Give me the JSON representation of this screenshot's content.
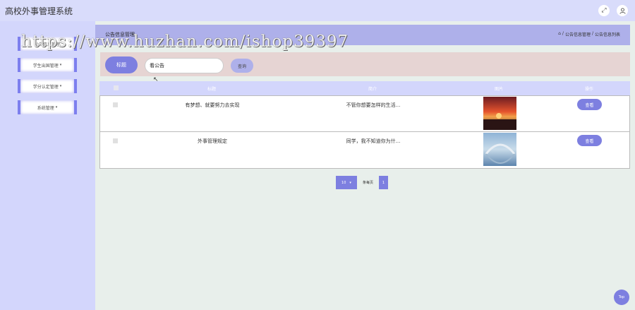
{
  "app": {
    "title": "高校外事管理系统"
  },
  "header_icons": [
    "fullscreen-icon",
    "user-icon"
  ],
  "sidebar": {
    "items": [
      {
        "label": "公告信息管理"
      },
      {
        "label": "学生出国管理"
      },
      {
        "label": "学分认定管理"
      },
      {
        "label": "系统管理"
      }
    ]
  },
  "page": {
    "title": "公告信息管理",
    "breadcrumb": [
      "公告信息管理",
      "公告信息列表"
    ]
  },
  "search": {
    "label": "标题",
    "value": "看公告",
    "button": "查询"
  },
  "table": {
    "headers": [
      "标题",
      "简介",
      "图片",
      "操作"
    ],
    "rows": [
      {
        "title": "有梦想、就要努力去实现",
        "intro": "不管你想要怎样的生活...",
        "action": "查看"
      },
      {
        "title": "外事管理规定",
        "intro": "同学，我不知道你为什...",
        "action": "查看"
      }
    ]
  },
  "pagination": {
    "page_size": "10",
    "text": "条每页",
    "current": "1"
  },
  "watermark": "https://www.huzhan.com/ishop39397",
  "back_to_top": "Top",
  "colors": {
    "accent": "#7d7fe0",
    "sidebar": "#d3d6fc",
    "header": "#aeb0ea",
    "search_bg": "#e6d4d3"
  }
}
